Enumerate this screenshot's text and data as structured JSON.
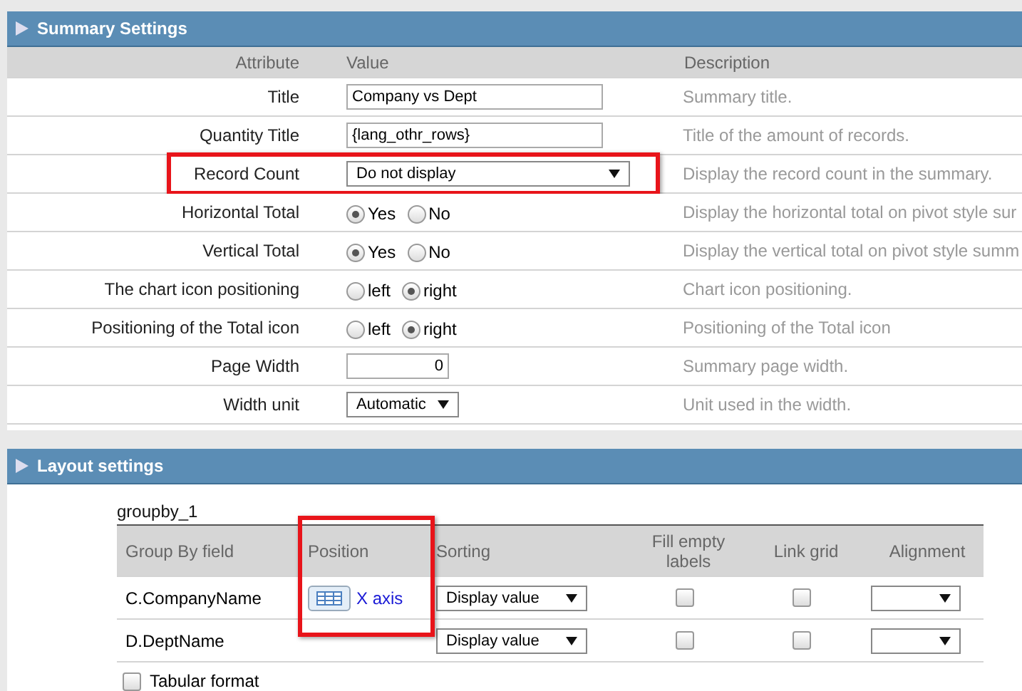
{
  "summary": {
    "title": "Summary Settings",
    "columns": [
      "Attribute",
      "Value",
      "Description"
    ],
    "rows": [
      {
        "kind": "text",
        "label": "Title",
        "value": "Company vs Dept",
        "description": "Summary title.",
        "highlighted": false
      },
      {
        "kind": "text",
        "label": "Quantity Title",
        "value": "{lang_othr_rows}",
        "description": "Title of the amount of records.",
        "highlighted": false
      },
      {
        "kind": "select",
        "label": "Record Count",
        "value": "Do not display",
        "description": "Display the record count in the summary.",
        "highlighted": true
      },
      {
        "kind": "radio",
        "label": "Horizontal Total",
        "options": [
          {
            "label": "Yes",
            "selected": true
          },
          {
            "label": "No",
            "selected": false
          }
        ],
        "description": "Display the horizontal total on pivot style sur",
        "highlighted": false
      },
      {
        "kind": "radio",
        "label": "Vertical Total",
        "options": [
          {
            "label": "Yes",
            "selected": true
          },
          {
            "label": "No",
            "selected": false
          }
        ],
        "description": "Display the vertical total on pivot style summ",
        "highlighted": false
      },
      {
        "kind": "radio",
        "label": "The chart icon positioning",
        "options": [
          {
            "label": "left",
            "selected": false
          },
          {
            "label": "right",
            "selected": true
          }
        ],
        "description": "Chart icon positioning.",
        "highlighted": false
      },
      {
        "kind": "radio",
        "label": "Positioning of the Total icon",
        "options": [
          {
            "label": "left",
            "selected": false
          },
          {
            "label": "right",
            "selected": true
          }
        ],
        "description": "Positioning of the Total icon",
        "highlighted": false
      },
      {
        "kind": "number",
        "label": "Page Width",
        "value": "0",
        "description": "Summary page width.",
        "highlighted": false
      },
      {
        "kind": "smallselect",
        "label": "Width unit",
        "value": "Automatic",
        "description": "Unit used in the width.",
        "highlighted": false
      }
    ]
  },
  "layout": {
    "title": "Layout settings",
    "group_label": "groupby_1",
    "columns": [
      {
        "label": "Group By field",
        "highlighted": false
      },
      {
        "label": "Position",
        "highlighted": true
      },
      {
        "label": "Sorting",
        "highlighted": false
      },
      {
        "label": "Fill empty labels",
        "highlighted": false
      },
      {
        "label": "Link grid",
        "highlighted": false
      },
      {
        "label": "Alignment",
        "highlighted": false
      }
    ],
    "rows": [
      {
        "field": "C.CompanyName",
        "position": "X axis",
        "sorting": "Display value",
        "fill_empty": false,
        "link_grid": false
      },
      {
        "field": "D.DeptName",
        "sorting": "Display value",
        "fill_empty": false,
        "link_grid": false
      }
    ],
    "tabular_format": {
      "label": "Tabular format",
      "checked": false
    }
  }
}
